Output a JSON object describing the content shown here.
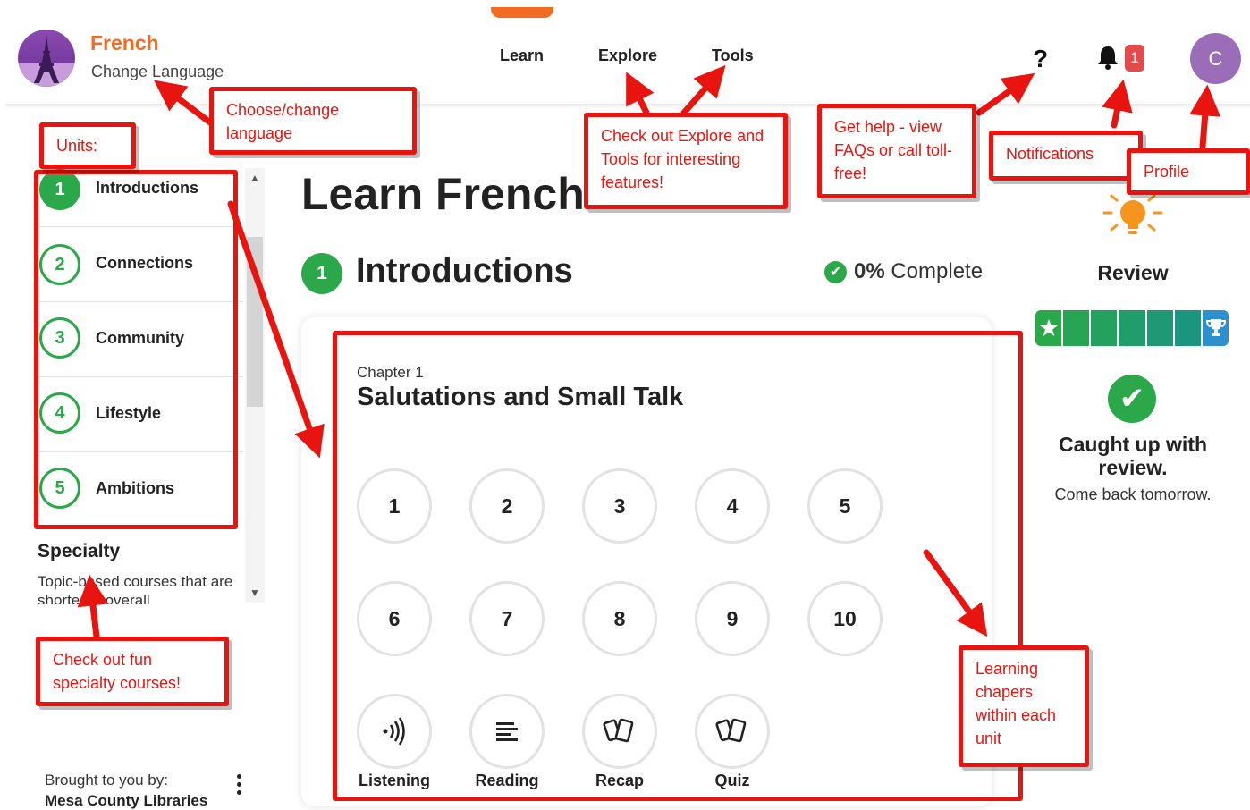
{
  "header": {
    "language_name": "French",
    "change_language": "Change Language",
    "nav": [
      {
        "label": "Learn"
      },
      {
        "label": "Explore"
      },
      {
        "label": "Tools"
      }
    ],
    "help_symbol": "?",
    "notification_count": "1",
    "profile_initial": "C"
  },
  "sidebar": {
    "units": [
      {
        "number": "1",
        "label": "Introductions"
      },
      {
        "number": "2",
        "label": "Connections"
      },
      {
        "number": "3",
        "label": "Community"
      },
      {
        "number": "4",
        "label": "Lifestyle"
      },
      {
        "number": "5",
        "label": "Ambitions"
      }
    ],
    "specialty_title": "Specialty",
    "specialty_desc": "Topic-based courses that are shorter in overall",
    "brought_by_label": "Brought to you by:",
    "brought_by_org": "Mesa County Libraries"
  },
  "main": {
    "page_title": "Learn French",
    "unit_number": "1",
    "unit_title": "Introductions",
    "progress_percent": "0%",
    "progress_suffix": "Complete",
    "chapter_label": "Chapter 1",
    "chapter_title": "Salutations and Small Talk",
    "lessons": [
      "1",
      "2",
      "3",
      "4",
      "5",
      "6",
      "7",
      "8",
      "9",
      "10"
    ],
    "activities": [
      {
        "label": "Listening",
        "icon": "listening-icon"
      },
      {
        "label": "Reading",
        "icon": "reading-icon"
      },
      {
        "label": "Recap",
        "icon": "cards-icon"
      },
      {
        "label": "Quiz",
        "icon": "cards-icon"
      }
    ]
  },
  "review": {
    "title": "Review",
    "caught_up_title": "Caught up with review.",
    "caught_up_sub": "Come back tomorrow.",
    "bar_colors": [
      "#2ba84a",
      "#27a554",
      "#24a15e",
      "#219d69",
      "#1e9973",
      "#1b957e",
      "#2c8fd0"
    ]
  },
  "annotations": {
    "units": "Units:",
    "choose_language": "Choose/change language",
    "explore_tools": "Check out Explore and Tools for interesting features!",
    "help": "Get help - view FAQs or call toll-free!",
    "notifications": "Notifications",
    "profile": "Profile",
    "specialty": "Check out fun specialty courses!",
    "chapters": "Learning chapers within each unit"
  },
  "colors": {
    "accent_orange": "#f26b21",
    "unit_green": "#2ba84a",
    "annotation_red": "#e8140f",
    "avatar_purple": "#9b6db8"
  }
}
